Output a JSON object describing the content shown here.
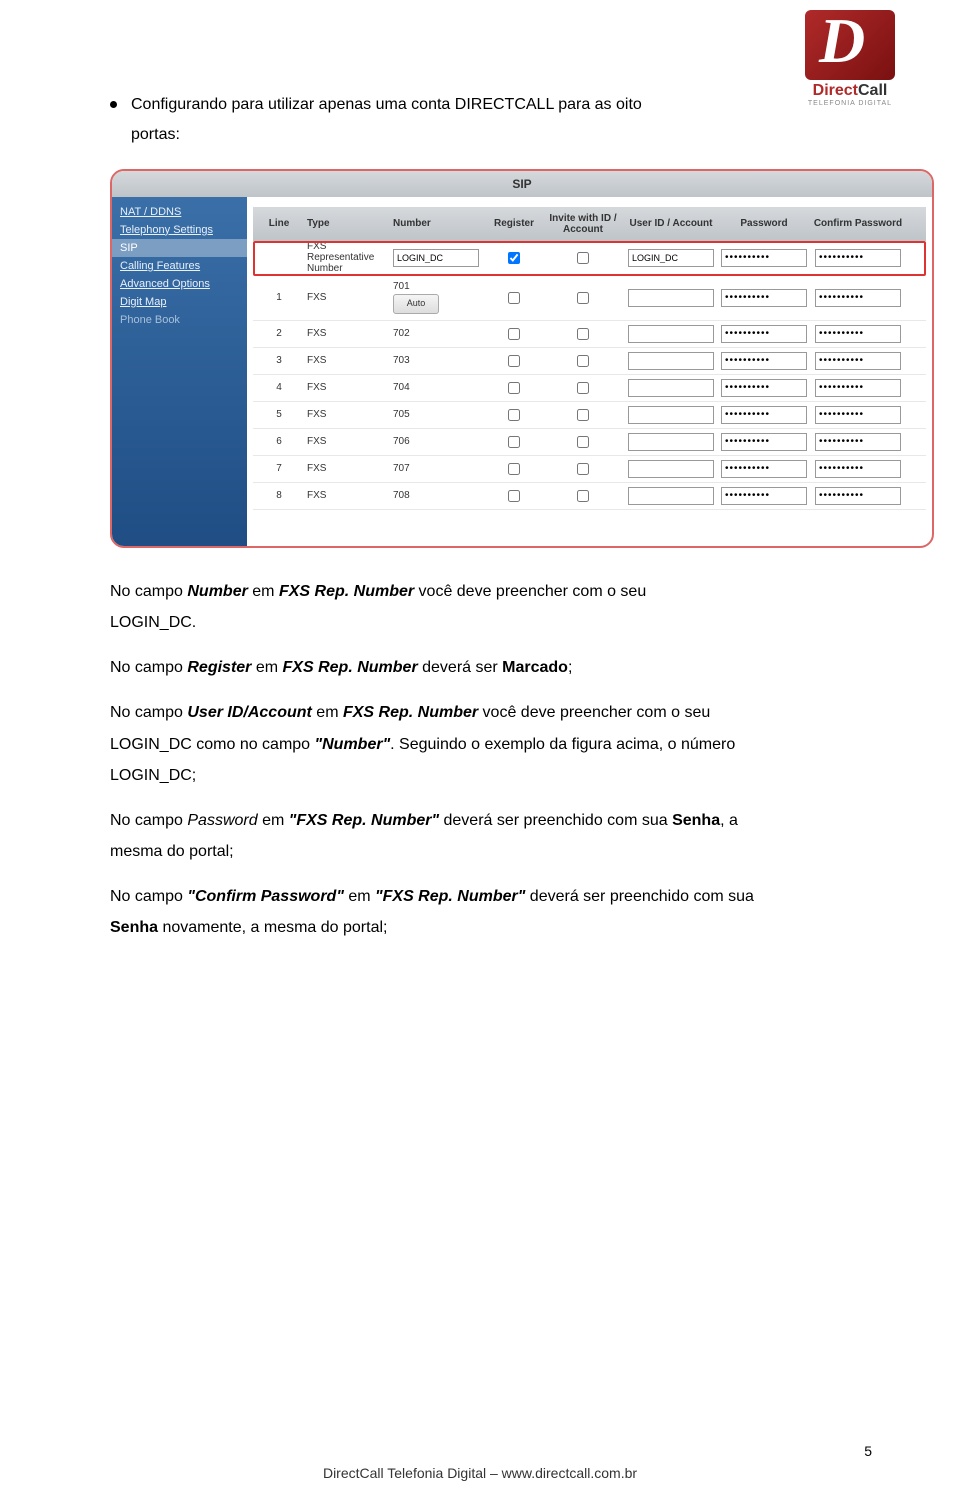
{
  "logo": {
    "brand1": "Direct",
    "brand2": "Call",
    "sub": "TELEFONIA DIGITAL"
  },
  "bullet": {
    "line1": "Configurando para utilizar apenas uma conta DIRECTCALL para as oito",
    "line2": "portas:"
  },
  "sip": {
    "title": "SIP",
    "sidebar": [
      "NAT / DDNS",
      "Telephony Settings",
      "SIP",
      "Calling Features",
      "Advanced Options",
      "Digit Map",
      "Phone Book"
    ],
    "headers": {
      "line": "Line",
      "type": "Type",
      "number": "Number",
      "register": "Register",
      "invite": "Invite with ID / Account",
      "userid": "User ID / Account",
      "password": "Password",
      "confirm": "Confirm Password"
    },
    "rep": {
      "type": "FXS Representative Number",
      "number": "LOGIN_DC",
      "register": true,
      "invite": false,
      "userid": "LOGIN_DC",
      "password": "••••••••••",
      "confirm": "••••••••••"
    },
    "rows": [
      {
        "line": "1",
        "type": "FXS",
        "number": "701",
        "auto": "Auto"
      },
      {
        "line": "2",
        "type": "FXS",
        "number": "702"
      },
      {
        "line": "3",
        "type": "FXS",
        "number": "703"
      },
      {
        "line": "4",
        "type": "FXS",
        "number": "704"
      },
      {
        "line": "5",
        "type": "FXS",
        "number": "705"
      },
      {
        "line": "6",
        "type": "FXS",
        "number": "706"
      },
      {
        "line": "7",
        "type": "FXS",
        "number": "707"
      },
      {
        "line": "8",
        "type": "FXS",
        "number": "708"
      }
    ],
    "pw_mask": "••••••••••"
  },
  "p1": {
    "a": "No campo ",
    "b": "Number",
    "c": " em ",
    "d": "FXS Rep. Number",
    "e": " você deve preencher com o seu",
    "f": "LOGIN_DC."
  },
  "p2": {
    "a": "No campo ",
    "b": "Register",
    "c": " em ",
    "d": "FXS Rep. Number",
    "e": " deverá ser ",
    "f": "Marcado",
    "g": ";"
  },
  "p3": {
    "a": "No campo ",
    "b": "User ID/Account",
    "c": " em ",
    "d": "FXS Rep. Number",
    "e": " você deve preencher com o seu",
    "f": "LOGIN_DC como no campo ",
    "g": "\"Number\"",
    "h": ". Seguindo o exemplo da figura acima, o número",
    "i": "LOGIN_DC;"
  },
  "p4": {
    "a": "No campo ",
    "b": "Password ",
    "c": "em ",
    "d": "\"FXS Rep. Number\"",
    "e": " deverá ser preenchido com sua ",
    "f": "Senha",
    "g": ", a",
    "h": "mesma do portal;"
  },
  "p5": {
    "a": "No campo ",
    "b": "\"Confirm Password\"",
    "c": " em ",
    "d": "\"FXS Rep. Number\"",
    "e": " deverá ser preenchido com sua",
    "f": "Senha",
    "g": " novamente, a mesma do portal;"
  },
  "footer": "DirectCall Telefonia Digital – www.directcall.com.br",
  "page_num": "5"
}
